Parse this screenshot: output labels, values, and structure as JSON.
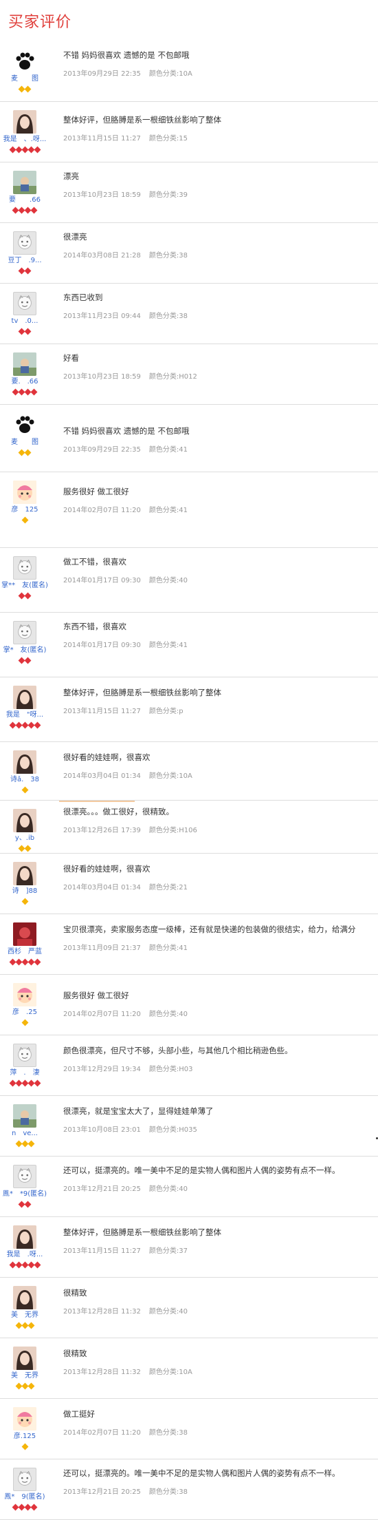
{
  "page_title": "买家评价",
  "reviews": [
    {
      "nick": "麦　　图",
      "text": "不错 妈妈很喜欢 遗憾的是 不包邮哦",
      "date": "2013年09月29日 22:35",
      "spec": "颜色分类:10A",
      "badge": "gold",
      "badge_count": 2,
      "avatar": "paw",
      "avatar_icon": "paw-icon"
    },
    {
      "nick": "我是　、.呀...",
      "text": "整体好评，但胳膊是系一根细铁丝影响了整体",
      "date": "2013年11月15日 11:27",
      "spec": "颜色分类:15",
      "badge": "red",
      "badge_count": 5,
      "avatar": "girl",
      "avatar_icon": "user-photo-icon"
    },
    {
      "nick": "要　　.66",
      "text": "漂亮",
      "date": "2013年10月23日 18:59",
      "spec": "颜色分类:39",
      "badge": "red",
      "badge_count": 4,
      "avatar": "photo",
      "avatar_icon": "user-photo-icon"
    },
    {
      "nick": "豆丁　.9...",
      "text": "很漂亮",
      "date": "2014年03月08日 21:28",
      "spec": "颜色分类:38",
      "badge": "red",
      "badge_count": 2,
      "avatar": "default",
      "avatar_icon": "default-avatar-icon"
    },
    {
      "nick": "tv　.0...",
      "text": "东西已收到",
      "date": "2013年11月23日 09:44",
      "spec": "颜色分类:38",
      "badge": "red",
      "badge_count": 2,
      "avatar": "default",
      "avatar_icon": "default-avatar-icon"
    },
    {
      "nick": "要.　.66",
      "text": "好看",
      "date": "2013年10月23日 18:59",
      "spec": "颜色分类:H012",
      "badge": "red",
      "badge_count": 4,
      "avatar": "photo",
      "avatar_icon": "user-photo-icon"
    },
    {
      "nick": "麦　　图",
      "text": "不错 妈妈很喜欢 遗憾的是 不包邮哦",
      "date": "2013年09月29日 22:35",
      "spec": "颜色分类:41",
      "badge": "gold",
      "badge_count": 2,
      "avatar": "paw",
      "avatar_icon": "paw-icon"
    },
    {
      "nick": "彦　125",
      "text": "服务很好 做工很好",
      "date": "2014年02月07日 11:20",
      "spec": "颜色分类:41",
      "badge": "gold",
      "badge_count": 1,
      "avatar": "cartoon",
      "avatar_icon": "cartoon-avatar-icon"
    },
    {
      "nick": "掌**　友(匿名)",
      "text": "做工不错，很喜欢",
      "date": "2014年01月17日 09:30",
      "spec": "颜色分类:40",
      "badge": "red",
      "badge_count": 2,
      "avatar": "default",
      "avatar_icon": "default-avatar-icon"
    },
    {
      "nick": "掌*　友(匿名)",
      "text": "东西不错，很喜欢",
      "date": "2014年01月17日 09:30",
      "spec": "颜色分类:41",
      "badge": "red",
      "badge_count": 2,
      "avatar": "default",
      "avatar_icon": "default-avatar-icon"
    },
    {
      "nick": "我是　\"呀...",
      "text": "整体好评，但胳膊是系一根细铁丝影响了整体",
      "date": "2013年11月15日 11:27",
      "spec": "颜色分类:p",
      "badge": "red",
      "badge_count": 5,
      "avatar": "girl",
      "avatar_icon": "user-photo-icon"
    },
    {
      "nick": "诗ǎ.　38",
      "text": "很好看的娃娃啊，很喜欢",
      "date": "2014年03月04日 01:34",
      "spec": "颜色分类:10A",
      "badge": "gold",
      "badge_count": 1,
      "avatar": "girl",
      "avatar_icon": "user-photo-icon"
    },
    {
      "nick": "y、.ib",
      "text": "很漂亮。。。做工很好，很精致。",
      "date": "2013年12月26日 17:39",
      "spec": "颜色分类:H106",
      "badge": "gold",
      "badge_count": 2,
      "avatar": "girl",
      "avatar_icon": "user-photo-icon"
    },
    {
      "nick": "诗　]88",
      "text": "很好看的娃娃啊，很喜欢",
      "date": "2014年03月04日 01:34",
      "spec": "颜色分类:21",
      "badge": "gold",
      "badge_count": 1,
      "avatar": "girl",
      "avatar_icon": "user-photo-icon"
    },
    {
      "nick": "西杉　严蓝",
      "text": "宝贝很漂亮，卖家服务态度一级棒，还有就是快递的包装做的很结实，给力，给满分",
      "date": "2013年11月09日 21:37",
      "spec": "颜色分类:41",
      "badge": "red",
      "badge_count": 5,
      "avatar": "red",
      "avatar_icon": "user-photo-icon"
    },
    {
      "nick": "彦　.25",
      "text": "服务很好 做工很好",
      "date": "2014年02月07日 11:20",
      "spec": "颜色分类:40",
      "badge": "gold",
      "badge_count": 1,
      "avatar": "cartoon",
      "avatar_icon": "cartoon-avatar-icon"
    },
    {
      "nick": "萍　.　淒",
      "text": "颜色很漂亮，但尺寸不够，头部小些，与其他几个相比稍逊色些。",
      "date": "2013年12月29日 19:34",
      "spec": "颜色分类:H03",
      "badge": "red",
      "badge_count": 5,
      "avatar": "default",
      "avatar_icon": "default-avatar-icon"
    },
    {
      "nick": "n　ve...",
      "text": "很漂亮，就是宝宝太大了，显得娃娃单薄了",
      "date": "2013年10月08日 23:01",
      "spec": "颜色分类:H035",
      "badge": "gold",
      "badge_count": 3,
      "avatar": "photo",
      "avatar_icon": "user-photo-icon"
    },
    {
      "nick": "鳯*　*9(匿名)",
      "text": "还可以，挺漂亮的。唯一美中不足的是实物人偶和图片人偶的姿势有点不一样。",
      "date": "2013年12月21日 20:25",
      "spec": "颜色分类:40",
      "badge": "red",
      "badge_count": 2,
      "avatar": "default",
      "avatar_icon": "default-avatar-icon"
    },
    {
      "nick": "我是　.呀...",
      "text": "整体好评，但胳膊是系一根细铁丝影响了整体",
      "date": "2013年11月15日 11:27",
      "spec": "颜色分类:37",
      "badge": "red",
      "badge_count": 5,
      "avatar": "girl",
      "avatar_icon": "user-photo-icon"
    },
    {
      "nick": "美　无界",
      "text": "很精致",
      "date": "2013年12月28日 11:32",
      "spec": "颜色分类:40",
      "badge": "gold",
      "badge_count": 3,
      "avatar": "girl",
      "avatar_icon": "user-photo-icon"
    },
    {
      "nick": "美　无界",
      "text": "很精致",
      "date": "2013年12月28日 11:32",
      "spec": "颜色分类:10A",
      "badge": "gold",
      "badge_count": 3,
      "avatar": "girl",
      "avatar_icon": "user-photo-icon"
    },
    {
      "nick": "彦.125",
      "text": "做工挺好",
      "date": "2014年02月07日 11:20",
      "spec": "颜色分类:38",
      "badge": "gold",
      "badge_count": 1,
      "avatar": "cartoon",
      "avatar_icon": "cartoon-avatar-icon"
    },
    {
      "nick": "鳯*　9(匿名)",
      "text": "还可以，挺漂亮的。唯一美中不足的是实物人偶和图片人偶的姿势有点不一样。",
      "date": "2013年12月21日 20:25",
      "spec": "颜色分类:38",
      "badge": "red",
      "badge_count": 4,
      "avatar": "default",
      "avatar_icon": "default-avatar-icon"
    }
  ]
}
